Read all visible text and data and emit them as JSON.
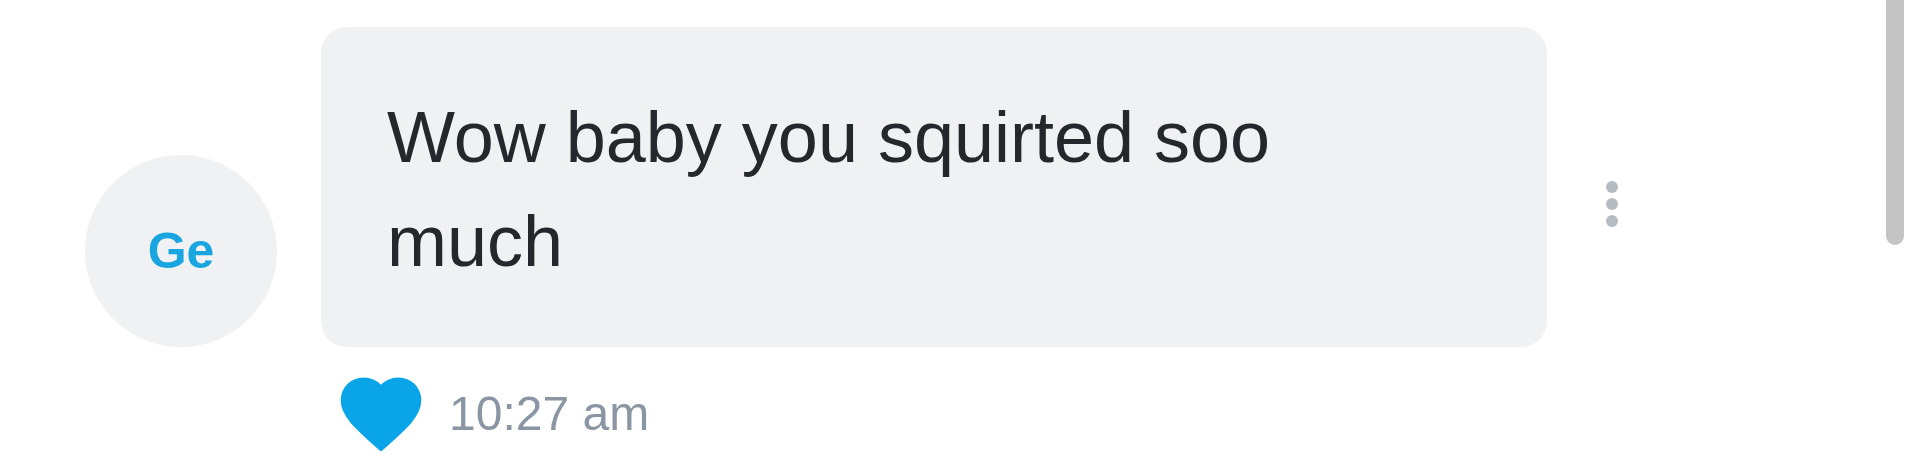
{
  "message": {
    "avatar_initials": "Ge",
    "text": "Wow baby you squirted soo much",
    "liked": true,
    "time": "10:27 am"
  }
}
